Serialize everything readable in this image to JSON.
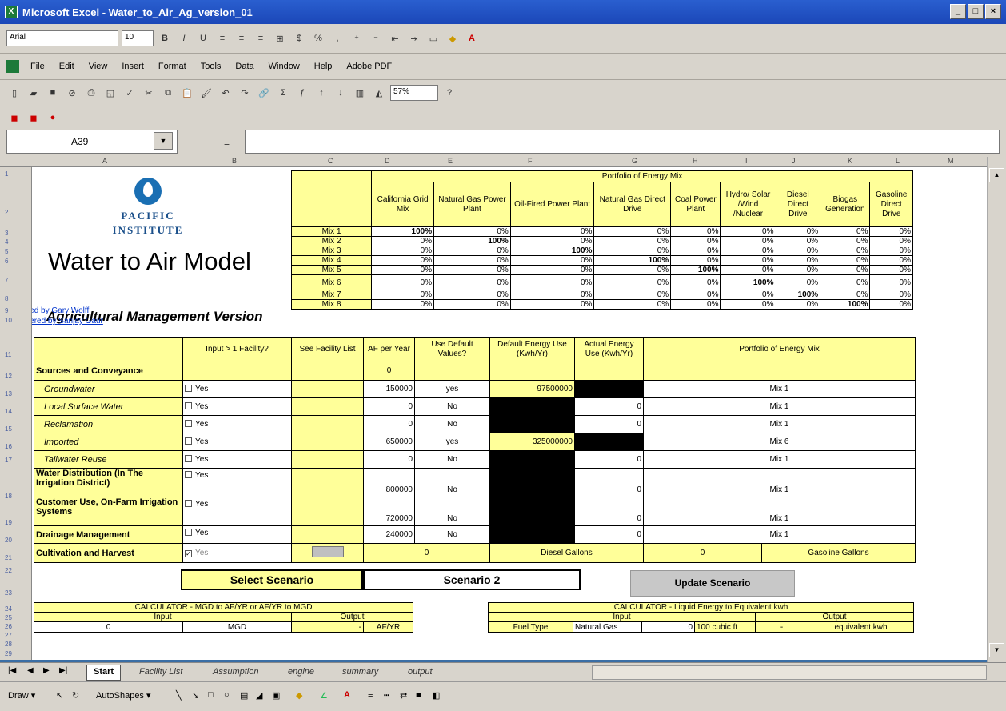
{
  "window": {
    "title": "Microsoft Excel - Water_to_Air_Ag_version_01",
    "min": "_",
    "max": "□",
    "close": "×"
  },
  "menu": [
    "File",
    "Edit",
    "View",
    "Insert",
    "Format",
    "Tools",
    "Data",
    "Window",
    "Help",
    "Adobe PDF"
  ],
  "toolbar": {
    "font": "Arial",
    "size": "10",
    "zoom": "57%"
  },
  "namebox": "A39",
  "fx": "=",
  "columns": [
    "A",
    "B",
    "C",
    "D",
    "E",
    "F",
    "G",
    "H",
    "I",
    "J",
    "K",
    "L",
    "M"
  ],
  "rows": [
    "1",
    "2",
    "3",
    "4",
    "5",
    "6",
    "7",
    "8",
    "9",
    "10",
    "11",
    "12",
    "13",
    "14",
    "15",
    "16",
    "17",
    "18",
    "19",
    "20",
    "21",
    "22",
    "23",
    "24",
    "25",
    "26",
    "27",
    "28",
    "29"
  ],
  "logo": {
    "line1": "PACIFIC",
    "line2": "INSTITUTE"
  },
  "model": {
    "title": "Water to Air Model",
    "subtitle": "Agricultural Management Version",
    "credit1": "Designed by Gary Wolff",
    "credit2": "Engineered by Sanjay Gaur"
  },
  "mix_table": {
    "header": "Portfolio of Energy Mix",
    "columns": [
      "California Grid Mix",
      "Natural Gas Power Plant",
      "Oil-Fired Power Plant",
      "Natural Gas Direct Drive",
      "Coal Power Plant",
      "Hydro/ Solar /Wind /Nuclear",
      "Diesel Direct Drive",
      "Biogas Generation",
      "Gasoline Direct Drive"
    ],
    "rows": [
      {
        "label": "Mix 1",
        "v": [
          "100%",
          "0%",
          "0%",
          "0%",
          "0%",
          "0%",
          "0%",
          "0%",
          "0%"
        ]
      },
      {
        "label": "Mix 2",
        "v": [
          "0%",
          "100%",
          "0%",
          "0%",
          "0%",
          "0%",
          "0%",
          "0%",
          "0%"
        ]
      },
      {
        "label": "Mix 3",
        "v": [
          "0%",
          "0%",
          "100%",
          "0%",
          "0%",
          "0%",
          "0%",
          "0%",
          "0%"
        ]
      },
      {
        "label": "Mix 4",
        "v": [
          "0%",
          "0%",
          "0%",
          "100%",
          "0%",
          "0%",
          "0%",
          "0%",
          "0%"
        ]
      },
      {
        "label": "Mix 5",
        "v": [
          "0%",
          "0%",
          "0%",
          "0%",
          "100%",
          "0%",
          "0%",
          "0%",
          "0%"
        ]
      },
      {
        "label": "Mix 6",
        "v": [
          "0%",
          "0%",
          "0%",
          "0%",
          "0%",
          "100%",
          "0%",
          "0%",
          "0%"
        ]
      },
      {
        "label": "Mix 7",
        "v": [
          "0%",
          "0%",
          "0%",
          "0%",
          "0%",
          "0%",
          "100%",
          "0%",
          "0%"
        ]
      },
      {
        "label": "Mix 8",
        "v": [
          "0%",
          "0%",
          "0%",
          "0%",
          "0%",
          "0%",
          "0%",
          "100%",
          "0%"
        ]
      }
    ]
  },
  "main_table": {
    "headers": [
      "Input > 1 Facility?",
      "See Facility List",
      "AF per Year",
      "Use Default Values?",
      "Default Energy Use (Kwh/Yr)",
      "Actual Energy Use (Kwh/Yr)",
      "Portfolio of Energy Mix"
    ],
    "section": "Sources and Conveyance",
    "section_af": "0",
    "yes": "Yes",
    "rows": [
      {
        "label": "Groundwater",
        "af": "150000",
        "def": "yes",
        "default_energy": "97500000",
        "actual": "",
        "mix": "Mix 1"
      },
      {
        "label": "Local Surface Water",
        "af": "0",
        "def": "No",
        "default_energy": "",
        "actual": "0",
        "mix": "Mix 1"
      },
      {
        "label": "Reclamation",
        "af": "0",
        "def": "No",
        "default_energy": "",
        "actual": "0",
        "mix": "Mix 1"
      },
      {
        "label": "Imported",
        "af": "650000",
        "def": "yes",
        "default_energy": "325000000",
        "actual": "",
        "mix": "Mix 6"
      },
      {
        "label": "Tailwater Reuse",
        "af": "0",
        "def": "No",
        "default_energy": "",
        "actual": "0",
        "mix": "Mix 1"
      }
    ],
    "rows2": [
      {
        "label": "Water Distribution (In The Irrigation District)",
        "af": "800000",
        "def": "No",
        "actual": "0",
        "mix": "Mix 1"
      },
      {
        "label": "Customer Use, On-Farm Irrigation Systems",
        "af": "720000",
        "def": "No",
        "actual": "0",
        "mix": "Mix 1"
      },
      {
        "label": "Drainage Management",
        "af": "240000",
        "def": "No",
        "actual": "0",
        "mix": "Mix 1"
      }
    ],
    "cultivation": {
      "label": "Cultivation and Harvest",
      "v1": "0",
      "u1": "Diesel Gallons",
      "v2": "0",
      "u2": "Gasoline Gallons"
    }
  },
  "scenario": {
    "label": "Select Scenario",
    "value": "Scenario 2",
    "update": "Update Scenario"
  },
  "calc1": {
    "title": "CALCULATOR - MGD to AF/YR or AF/YR to MGD",
    "input": "Input",
    "output": "Output",
    "val": "0",
    "unit_in": "MGD",
    "out": "-",
    "unit_out": "AF/YR"
  },
  "calc2": {
    "title": "CALCULATOR - Liquid Energy to Equivalent kwh",
    "input": "Input",
    "output": "Output",
    "fuel_label": "Fuel Type",
    "fuel": "Natural Gas",
    "val": "0",
    "unit_in": "100 cubic ft",
    "out": "-",
    "unit_out": "equivalent kwh"
  },
  "tabs": [
    "Start",
    "Facility List",
    "Assumption",
    "engine",
    "summary",
    "output"
  ],
  "drawbar": {
    "draw": "Draw ▾",
    "autoshapes": "AutoShapes ▾"
  }
}
